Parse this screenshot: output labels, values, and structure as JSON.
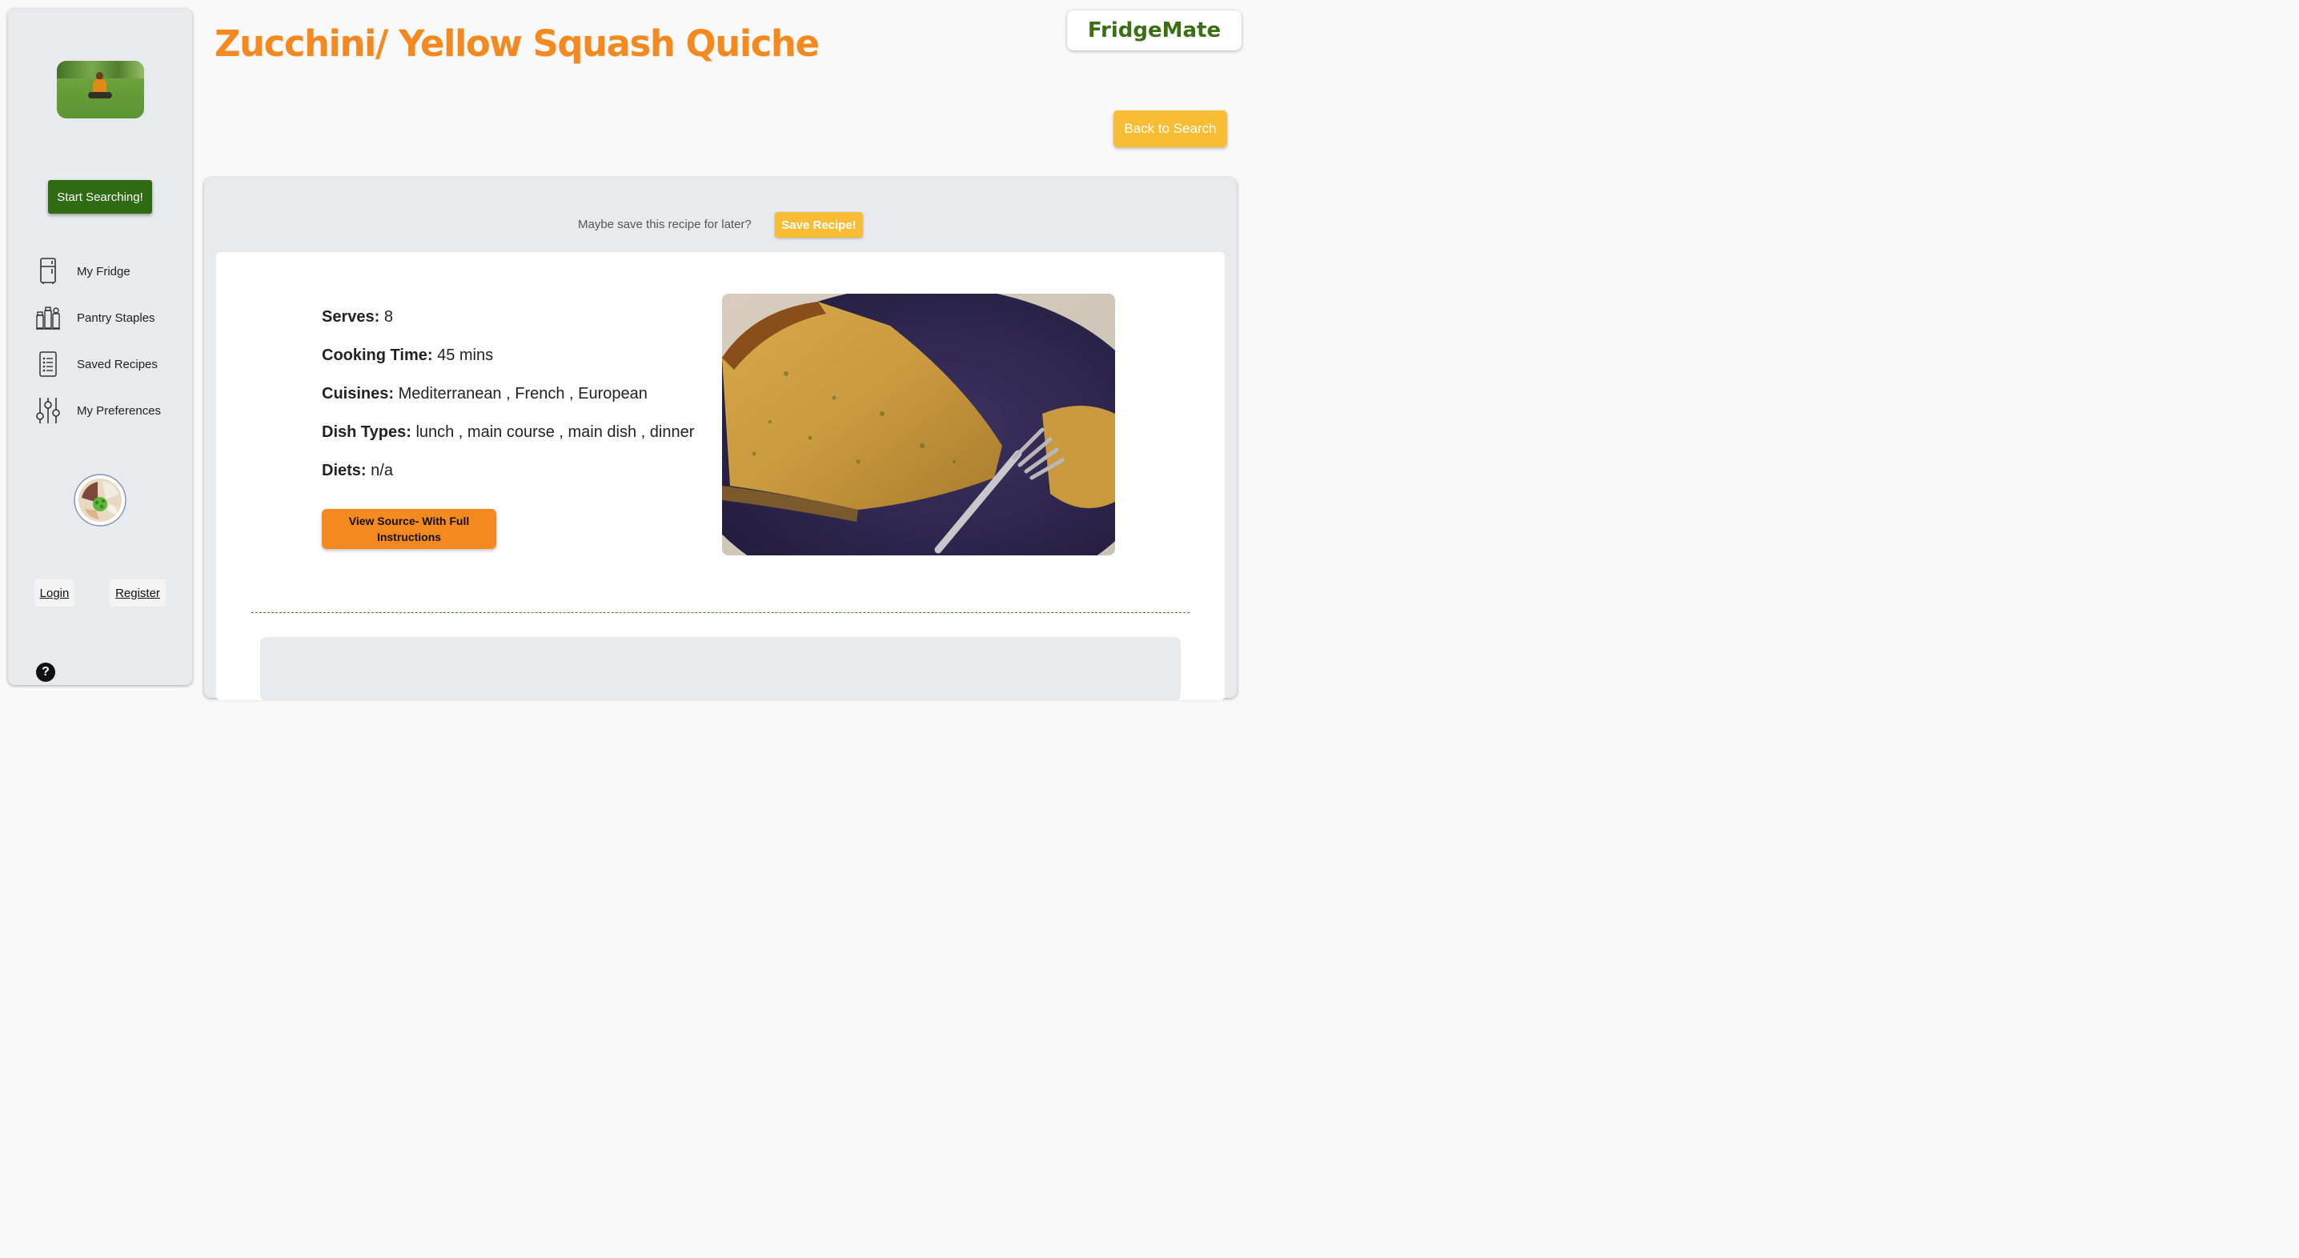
{
  "header": {
    "title": "Zucchini/ Yellow Squash Quiche",
    "brand": "FridgeMate",
    "back_label": "Back to Search"
  },
  "sidebar": {
    "start_label": "Start Searching!",
    "items": [
      {
        "label": "My Fridge",
        "icon": "fridge-icon"
      },
      {
        "label": "Pantry Staples",
        "icon": "pantry-jars-icon"
      },
      {
        "label": "Saved Recipes",
        "icon": "list-document-icon"
      },
      {
        "label": "My Preferences",
        "icon": "sliders-icon"
      }
    ],
    "login_label": "Login",
    "register_label": "Register",
    "help_label": "?"
  },
  "recipe": {
    "save_prompt": "Maybe save this recipe for later?",
    "save_label": "Save Recipe!",
    "serves_label": "Serves:",
    "serves": "8",
    "time_label": "Cooking Time:",
    "time": "45 mins",
    "cuisines_label": "Cuisines:",
    "cuisines": "Mediterranean , French , European",
    "dish_label": "Dish Types:",
    "dish_types": "lunch , main course , main dish , dinner",
    "diets_label": "Diets:",
    "diets": "n/a",
    "source_label": "View Source- With Full Instructions"
  },
  "colors": {
    "accent_orange": "#f4891f",
    "accent_yellow": "#f9bd35",
    "brand_green": "#3b6f14",
    "sidebar_green": "#2e6b12"
  }
}
